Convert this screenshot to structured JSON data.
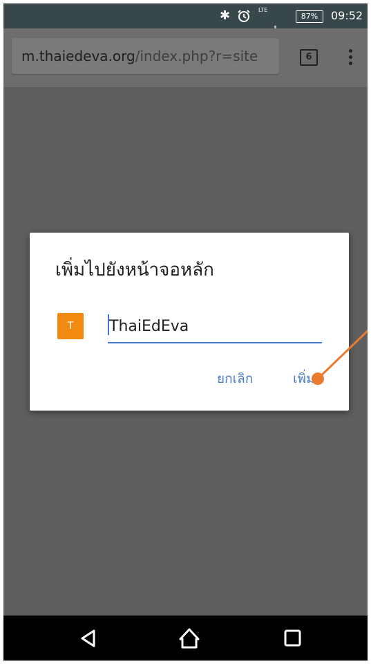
{
  "status_bar": {
    "network": "LTE",
    "battery": "87%",
    "time": "09:52"
  },
  "browser": {
    "url_host": "m.thaiedeva.org",
    "url_path": "/index.php?r=site",
    "tab_count": "6"
  },
  "dialog": {
    "title": "เพิ่มไปยังหน้าจอหลัก",
    "app_icon_letter": "T",
    "app_icon_color": "#f28a12",
    "name_value": "ThaiEdEva",
    "cancel_label": "ยกเลิก",
    "add_label": "เพิ่ม",
    "accent_color": "#3b78d3"
  },
  "annotation": {
    "color": "#ea7a2e",
    "target": "add-button"
  },
  "nav": {
    "back_icon": "back-triangle-icon",
    "home_icon": "home-icon",
    "recent_icon": "recent-apps-icon"
  }
}
